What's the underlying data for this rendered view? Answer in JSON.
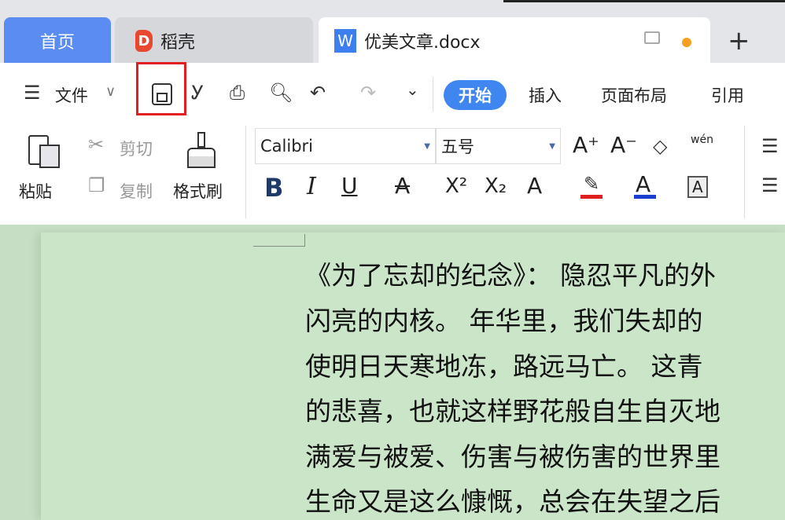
{
  "tabs": {
    "home": "首页",
    "docer": "稻壳",
    "doc": "优美文章.docx",
    "docer_logo": "D",
    "doc_logo": "W",
    "new_tab": "+"
  },
  "quick": {
    "menu_icon": "☰",
    "file": "文件",
    "chevron": "∨",
    "more": "⌄"
  },
  "ribbon_tabs": [
    "开始",
    "插入",
    "页面布局",
    "引用"
  ],
  "clipboard": {
    "paste": "粘贴",
    "cut": "剪切",
    "copy": "复制",
    "format_painter": "格式刷"
  },
  "font": {
    "name": "Calibri",
    "size": "五号",
    "grow": "A⁺",
    "shrink": "A⁻",
    "pinyin": "wén",
    "bold": "B",
    "italic": "I",
    "underline": "U",
    "strike": "A",
    "sup": "X²",
    "sub": "X₂",
    "effect": "A",
    "color": "A",
    "border": "A"
  },
  "colors": {
    "highlight": "#e02020",
    "font_color": "#1a3fd0",
    "accent": "#3f86f0"
  },
  "document": {
    "lines": [
      "《为了忘却的纪念》： 隐忍平凡的外",
      "闪亮的内核。 年华里，我们失却的",
      "使明日天寒地冻，路远马亡。 这青",
      "的悲喜，也就这样野花般自生自灭地",
      "满爱与被爱、伤害与被伤害的世界里",
      "生命又是这么慷慨，总会在失望之后"
    ]
  }
}
